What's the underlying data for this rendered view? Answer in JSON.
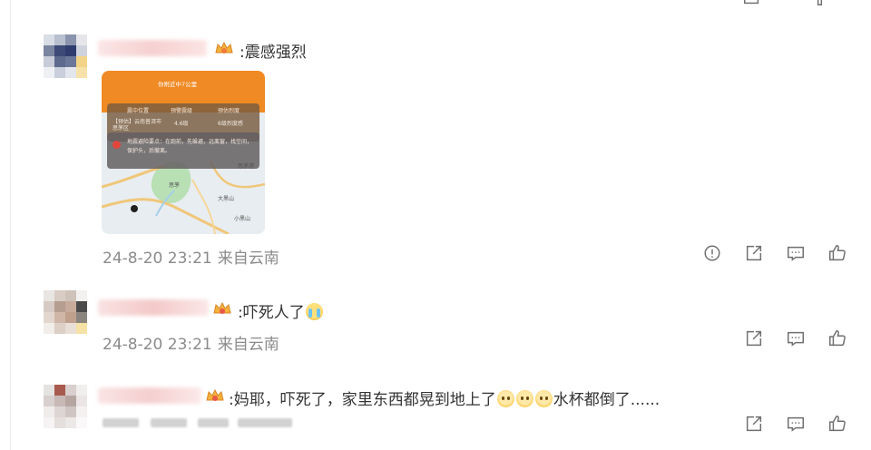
{
  "comments": [
    {
      "text": ":震感强烈",
      "has_image": true,
      "image": {
        "banner_line": "你附近中7公里",
        "info_labels": [
          "震中位置",
          "预警震级",
          "预估烈度"
        ],
        "location": "【预估】云南普洱市思茅区",
        "magnitude": "4.6级",
        "intensity": "6级烈度感",
        "warning": "地震避险要点：在跑前，先躲避，远离窗，找空间，保护头，后撤离。",
        "map_labels": [
          "思茅港",
          "思茅",
          "大黑山",
          "小黑山"
        ]
      },
      "timestamp": "24-8-20 23:21",
      "source": "来自云南",
      "actions": [
        "report-icon",
        "share-icon",
        "comment-icon",
        "like-icon"
      ]
    },
    {
      "text_prefix": ":吓死人了",
      "timestamp": "24-8-20 23:21",
      "source": "来自云南",
      "actions": [
        "share-icon",
        "comment-icon",
        "like-icon"
      ]
    },
    {
      "text_prefix": ":妈耶，吓死了，家里东西都晃到地上了",
      "text_suffix": "水杯都倒了......",
      "actions": [
        "share-icon",
        "comment-icon",
        "like-icon"
      ]
    }
  ],
  "colors": {
    "accent_orange": "#f08a24",
    "meta_gray": "#8b8b8b",
    "icon_gray": "#6f6f6f"
  }
}
